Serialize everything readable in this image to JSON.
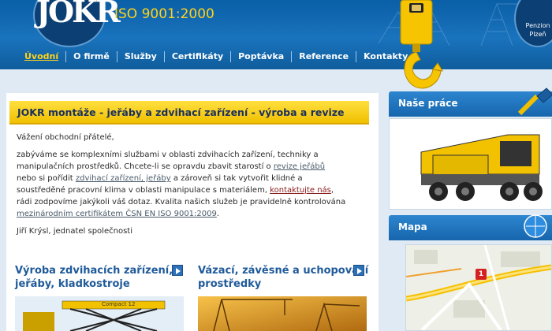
{
  "header": {
    "logo_text": "JOKR",
    "iso": "ISO 9001:2000",
    "penzion_line1": "Penzion",
    "penzion_line2": "Plzeň"
  },
  "nav": {
    "items": [
      {
        "label": "Úvodní",
        "active": true
      },
      {
        "label": "O firmě"
      },
      {
        "label": "Služby"
      },
      {
        "label": "Certifikáty"
      },
      {
        "label": "Poptávka"
      },
      {
        "label": "Reference"
      },
      {
        "label": "Kontakty"
      }
    ]
  },
  "main": {
    "title": "JOKR montáže - jeřáby a zdvihací zařízení - výroba a revize",
    "greeting": "Vážení obchodní přátelé,",
    "p1_a": "zabýváme se komplexními službami v oblasti zdvihacích zařízení, techniky a",
    "p1_b": "manipulačních prostředků. Chcete-li se opravdu zbavit starostí o ",
    "link_revize": "revize jeřábů",
    "p1_c": "nebo si pořídit ",
    "link_zarizeni": "zdvihací zařízení, jeřáby",
    "p1_d": " a zároveň si tak vytvořit klidné a",
    "p1_e": "soustředěné pracovní klima v oblasti manipulace s materiálem, ",
    "link_kontakt": "kontaktujte nás",
    "p1_f": ",",
    "p1_g": "rádi zodpovíme jakýkoli váš dotaz. Kvalita našich služeb je pravidelně kontrolována",
    "link_cert": "mezinárodním certifikátem ČSN EN ISO 9001:2009",
    "p1_h": ".",
    "signature": "Jiří Krýsl, jednatel společnosti"
  },
  "promos": [
    {
      "line1": "Výroba zdvihacích zařízení,",
      "line2": "jeřáby, kladkostroje",
      "img_label": "Compact 12"
    },
    {
      "line1": "Vázací, závěsné a uchopovací",
      "line2": "prostředky"
    }
  ],
  "sidebar": {
    "works_title": "Naše práce",
    "map_title": "Mapa",
    "map_marker": "1"
  },
  "colors": {
    "header_blue": "#1a73bd",
    "accent_yellow": "#ffd21a",
    "title_yellow": "#f0c000",
    "link_blue": "#1f5a9a"
  }
}
